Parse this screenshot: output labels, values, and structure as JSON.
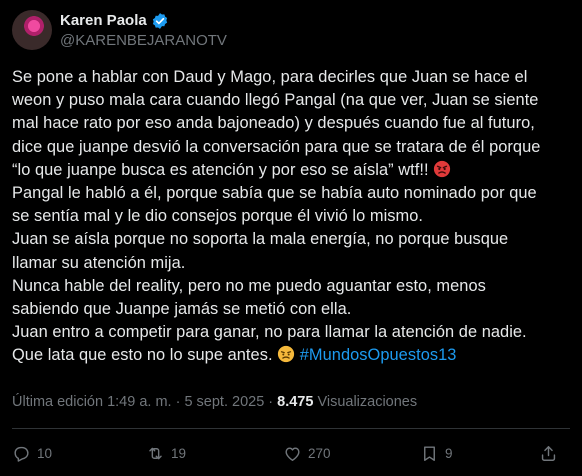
{
  "author": {
    "display_name": "Karen Paola",
    "handle": "@KARENBEJARANOTV"
  },
  "tweet": {
    "lines": [
      "Se pone a hablar con Daud y Mago, para decirles que Juan se hace el",
      "weon y puso mala cara cuando llegó Pangal (na que ver, Juan se siente",
      "mal hace rato por eso anda bajoneado) y después cuando fue al futuro,",
      "dice que juanpe desvió la conversación para que se tratara de él porque",
      "“lo que juanpe busca es atención y por eso se aísla” wtf!!",
      "Pangal le habló a él, porque sabía que se había auto nominado por que",
      "se sentía mal y le dio consejos porque él vivió lo mismo.",
      "Juan se aísla porque no soporta la mala energía, no porque busque",
      "llamar su atención mija.",
      "Nunca hable del reality, pero no me puedo aguantar esto, menos",
      "sabiendo que Juanpe jamás se metió con ella.",
      "Juan entro a competir para ganar, no para llamar la atención de nadie.",
      "Que lata que esto no lo supe antes."
    ],
    "hashtag": "#MundosOpuestos13",
    "emoji_angry": "angry-face-emoji",
    "emoji_annoyed": "annoyed-face-emoji"
  },
  "meta": {
    "edited": "Última edición 1:49 a. m. · 5 sept. 2025 ·",
    "views_count": "8.475",
    "views_label": "Visualizaciones"
  },
  "actions": {
    "replies": "10",
    "retweets": "19",
    "likes": "270",
    "bookmarks": "9"
  },
  "colors": {
    "background": "#000000",
    "text": "#e7e9ea",
    "secondary": "#71767b",
    "accent": "#1d9bf0",
    "divider": "#2f3336"
  }
}
